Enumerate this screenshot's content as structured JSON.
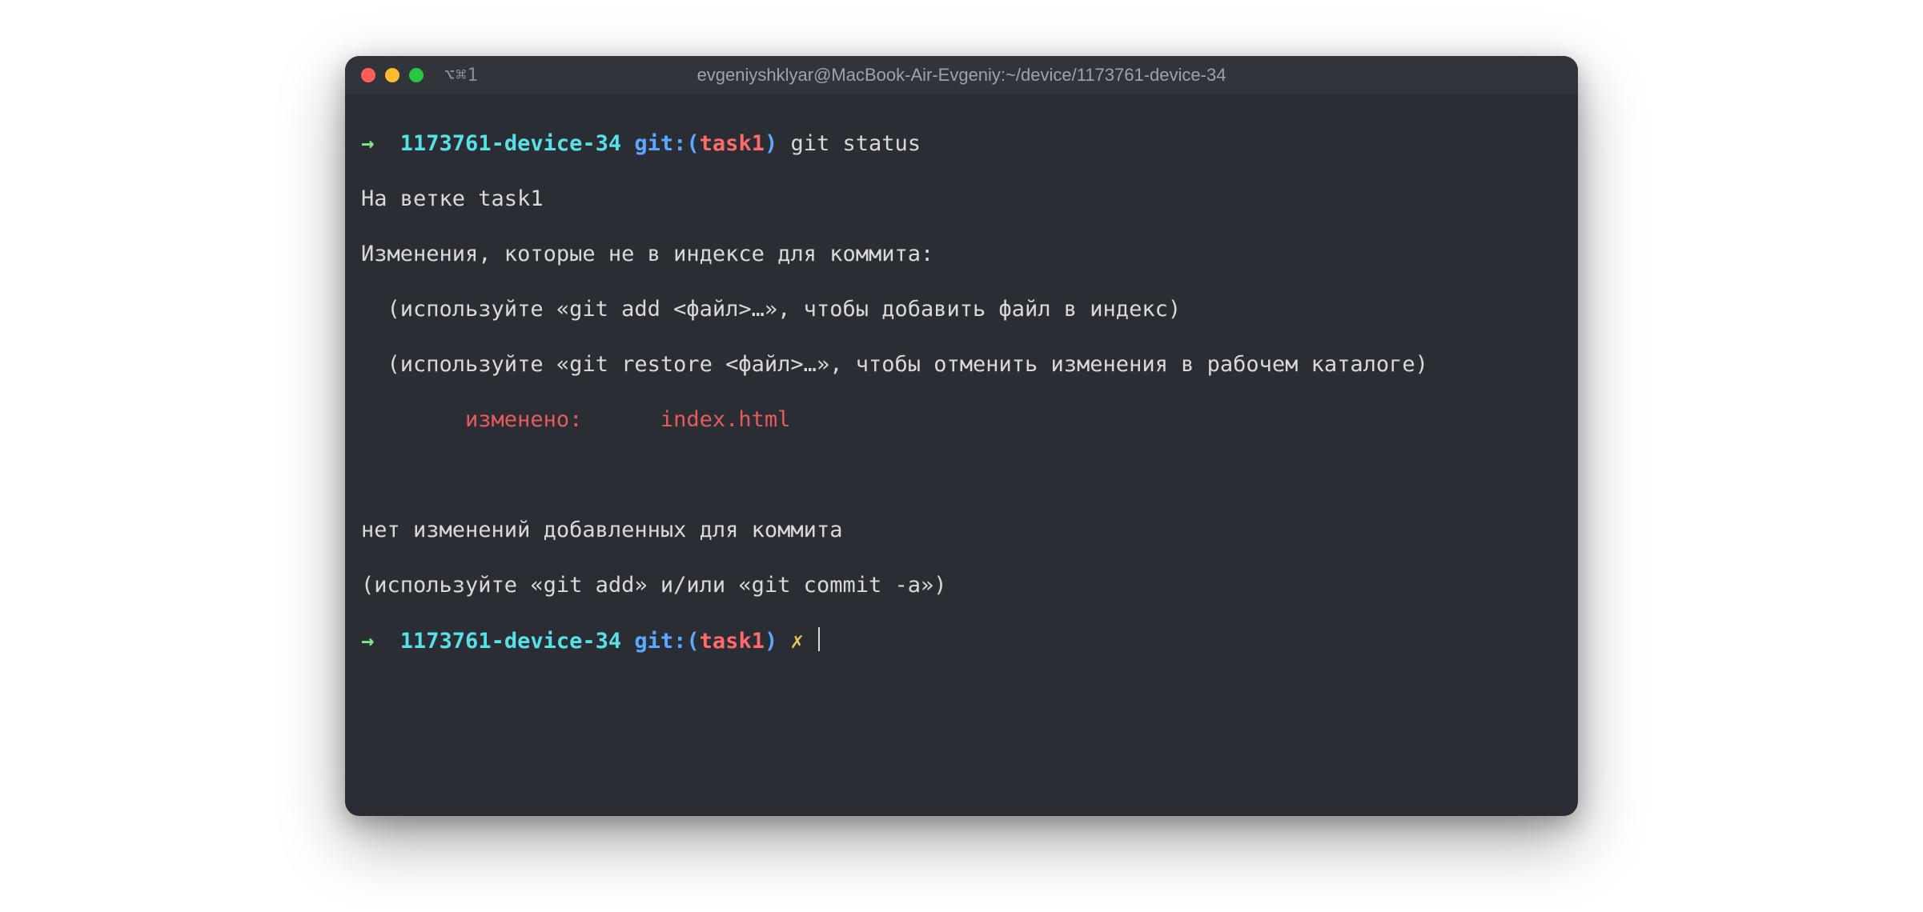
{
  "titlebar": {
    "hotkey_hint": "⌥⌘1",
    "title": "evgeniyshklyar@MacBook-Air-Evgeniy:~/device/1173761-device-34"
  },
  "prompt1": {
    "arrow": "→",
    "dir": "1173761-device-34",
    "git_label": "git:(",
    "branch": "task1",
    "git_close": ")",
    "command": "git status"
  },
  "output": {
    "l1": "На ветке task1",
    "l2": "Изменения, которые не в индексе для коммита:",
    "l3": "  (используйте «git add <файл>…», чтобы добавить файл в индекс)",
    "l4": "  (используйте «git restore <файл>…», чтобы отменить изменения в рабочем каталоге)",
    "mod_label": "        изменено:      ",
    "mod_file": "index.html",
    "l6": "нет изменений добавленных для коммита",
    "l7": "(используйте «git add» и/или «git commit -a»)"
  },
  "prompt2": {
    "arrow": "→",
    "dir": "1173761-device-34",
    "git_label": "git:(",
    "branch": "task1",
    "git_close": ")",
    "dirty": "✗"
  }
}
